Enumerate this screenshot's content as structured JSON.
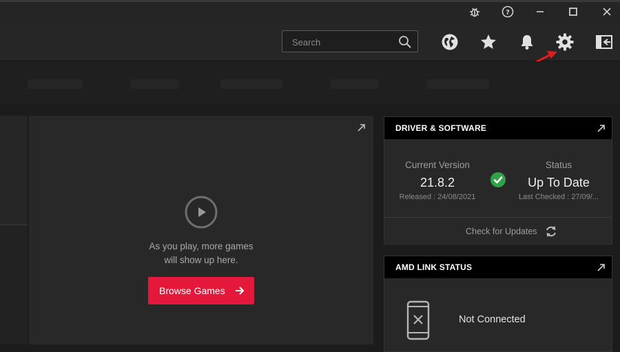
{
  "window": {
    "controls": [
      "bug-report",
      "help",
      "minimize",
      "maximize",
      "close"
    ]
  },
  "header": {
    "search": {
      "placeholder": "Search",
      "value": ""
    },
    "icons": [
      "globe",
      "favorites-star",
      "notifications-bell",
      "settings-gear",
      "exit-fullscreen"
    ]
  },
  "games_panel": {
    "message_line1": "As you play, more games",
    "message_line2": "will show up here.",
    "browse_button": "Browse Games"
  },
  "driver_card": {
    "title": "DRIVER & SOFTWARE",
    "current_version_label": "Current Version",
    "current_version": "21.8.2",
    "released": "Released : 24/08/2021",
    "status_label": "Status",
    "status_value": "Up To Date",
    "last_checked": "Last Checked : 27/09/...",
    "check_updates": "Check for Updates"
  },
  "amd_link_card": {
    "title": "AMD LINK STATUS",
    "status": "Not Connected"
  },
  "colors": {
    "accent_red": "#e4183b",
    "ok_green": "#2fa24a",
    "annotation_arrow": "#e21b1b"
  }
}
